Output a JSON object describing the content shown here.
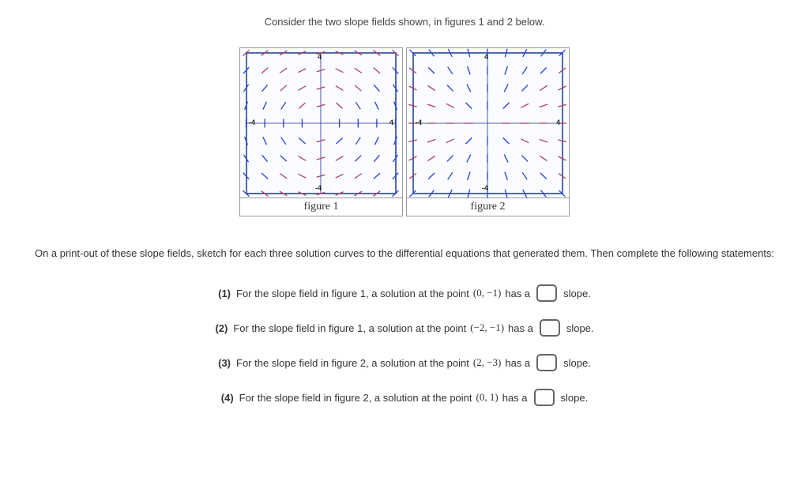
{
  "intro": "Consider the two slope fields shown, in figures 1 and 2 below.",
  "figures": {
    "fig1_caption": "figure 1",
    "fig2_caption": "figure 2",
    "axis": {
      "top": "4",
      "bottom": "-4",
      "left": "-4",
      "right": "4"
    }
  },
  "instructions": "On a print-out of these slope fields, sketch for each three solution curves to the differential equations that generated them. Then complete the following statements:",
  "questions": [
    {
      "num": "(1)",
      "pre": "For the slope field in figure 1, a solution at the point ",
      "point": "(0, −1)",
      "post1": " has a ",
      "post2": " slope."
    },
    {
      "num": "(2)",
      "pre": "For the slope field in figure 1, a solution at the point ",
      "point": "(−2, −1)",
      "post1": " has a ",
      "post2": " slope."
    },
    {
      "num": "(3)",
      "pre": "For the slope field in figure 2, a solution at the point ",
      "point": "(2, −3)",
      "post1": " has a ",
      "post2": " slope."
    },
    {
      "num": "(4)",
      "pre": "For the slope field in figure 2, a solution at the point ",
      "point": "(0, 1)",
      "post1": " has a ",
      "post2": " slope."
    }
  ]
}
